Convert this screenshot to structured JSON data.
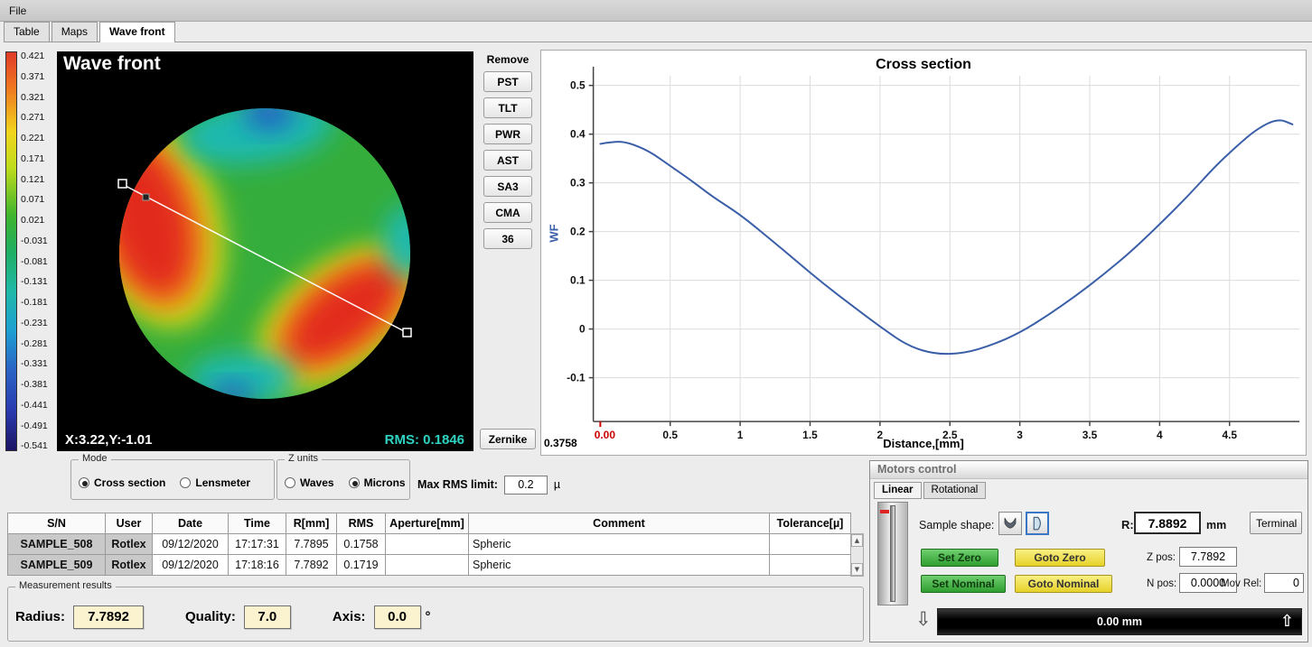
{
  "window": {
    "menu_file": "File"
  },
  "tabs": [
    {
      "label": "Table",
      "active": false
    },
    {
      "label": "Maps",
      "active": false
    },
    {
      "label": "Wave front",
      "active": true
    }
  ],
  "wavefront": {
    "title": "Wave front",
    "coords": "X:3.22,Y:-1.01",
    "rms": "RMS: 0.1846",
    "colorbar_labels": [
      "0.421",
      "0.371",
      "0.321",
      "0.271",
      "0.221",
      "0.171",
      "0.121",
      "0.071",
      "0.021",
      "-0.031",
      "-0.081",
      "-0.131",
      "-0.181",
      "-0.231",
      "-0.281",
      "-0.331",
      "-0.381",
      "-0.441",
      "-0.491",
      "-0.541"
    ]
  },
  "remove_panel": {
    "title": "Remove",
    "buttons": [
      "PST",
      "TLT",
      "PWR",
      "AST",
      "SA3",
      "CMA",
      "36"
    ],
    "zernike": "Zernike"
  },
  "chart_data": {
    "type": "line",
    "title": "Cross section",
    "xlabel": "Distance,[mm]",
    "ylabel": "WF",
    "xlim": [
      -0.05,
      5.0
    ],
    "ylim": [
      -0.19,
      0.52
    ],
    "grid": true,
    "legend": false,
    "line_color": "#3a5fa8",
    "x_ticks": [
      0.5,
      1,
      1.5,
      2,
      2.5,
      3,
      3.5,
      4,
      4.5
    ],
    "x_tick_labels": [
      "0.5",
      "1",
      "1.5",
      "2",
      "2.5",
      "3",
      "3.5",
      "4",
      "4.5"
    ],
    "y_ticks": [
      -0.1,
      0,
      0.1,
      0.2,
      0.3,
      0.4,
      0.5
    ],
    "y_tick_labels": [
      "-0.1",
      "0",
      "0.1",
      "0.2",
      "0.3",
      "0.4",
      "0.5"
    ],
    "origin_label": "0.00",
    "corner_value": "0.3758",
    "series": [
      {
        "name": "WF cross section",
        "x": [
          0,
          0.1,
          0.2,
          0.35,
          0.5,
          0.65,
          0.8,
          1.0,
          1.2,
          1.4,
          1.6,
          1.8,
          2.0,
          2.2,
          2.4,
          2.6,
          2.8,
          3.0,
          3.2,
          3.4,
          3.6,
          3.8,
          4.0,
          4.2,
          4.4,
          4.55,
          4.7,
          4.85,
          4.95
        ],
        "y": [
          0.38,
          0.385,
          0.383,
          0.365,
          0.335,
          0.305,
          0.272,
          0.235,
          0.188,
          0.14,
          0.092,
          0.048,
          0.005,
          -0.035,
          -0.052,
          -0.05,
          -0.033,
          -0.008,
          0.028,
          0.068,
          0.112,
          0.16,
          0.215,
          0.272,
          0.335,
          0.375,
          0.412,
          0.432,
          0.42
        ]
      }
    ]
  },
  "mode_panel": {
    "title": "Mode",
    "options": [
      {
        "label": "Cross section",
        "selected": true
      },
      {
        "label": "Lensmeter",
        "selected": false
      }
    ]
  },
  "z_units_panel": {
    "title": "Z units",
    "options": [
      {
        "label": "Waves",
        "selected": false
      },
      {
        "label": "Microns",
        "selected": true
      }
    ]
  },
  "max_rms": {
    "label": "Max RMS limit:",
    "value": "0.2",
    "unit": "µ"
  },
  "results_table": {
    "headers": [
      "S/N",
      "User",
      "Date",
      "Time",
      "R[mm]",
      "RMS",
      "Aperture[mm]",
      "Comment",
      "Tolerance[µ]"
    ],
    "rows": [
      [
        "SAMPLE_508",
        "Rotlex",
        "09/12/2020",
        "17:17:31",
        "7.7895",
        "0.1758",
        "",
        "Spheric",
        ""
      ],
      [
        "SAMPLE_509",
        "Rotlex",
        "09/12/2020",
        "17:18:16",
        "7.7892",
        "0.1719",
        "",
        "Spheric",
        ""
      ]
    ]
  },
  "measurement_results": {
    "title": "Measurement results",
    "radius_label": "Radius:",
    "radius": "7.7892",
    "quality_label": "Quality:",
    "quality": "7.0",
    "axis_label": "Axis:",
    "axis": "0.0",
    "axis_unit": "°"
  },
  "motors": {
    "title": "Motors control",
    "tabs": [
      {
        "label": "Linear",
        "active": true
      },
      {
        "label": "Rotational",
        "active": false
      }
    ],
    "sample_shape_label": "Sample shape:",
    "r_label": "R:",
    "r_value": "7.8892",
    "r_unit": "mm",
    "terminal": "Terminal",
    "set_zero": "Set Zero",
    "goto_zero": "Goto Zero",
    "z_pos_label": "Z pos:",
    "z_pos": "7.7892",
    "set_nominal": "Set Nominal",
    "goto_nominal": "Goto Nominal",
    "n_pos_label": "N pos:",
    "n_pos": "0.0000",
    "mov_rel_label": "Mov Rel:",
    "mov_rel": "0",
    "position_bar": "0.00 mm"
  },
  "icons": {
    "scroll_up": "▲",
    "scroll_down": "▼",
    "move_down_arrow": "⇩",
    "move_up_arrow": "⇧"
  }
}
